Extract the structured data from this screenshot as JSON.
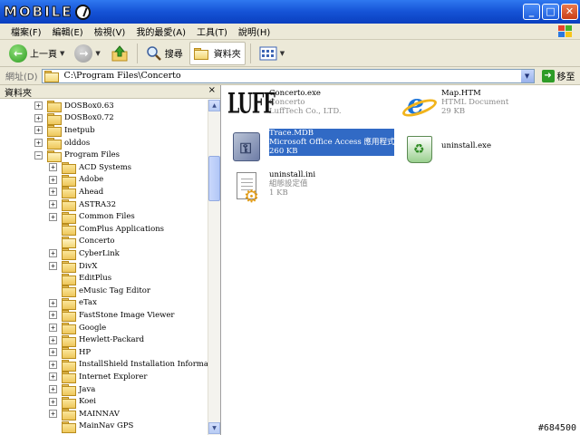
{
  "window": {
    "logo_text": "MOBILE",
    "controls": {
      "minimize": "_",
      "maximize": "□",
      "close": "✕"
    }
  },
  "menu": [
    "檔案(F)",
    "編輯(E)",
    "檢視(V)",
    "我的最愛(A)",
    "工具(T)",
    "說明(H)"
  ],
  "toolbar": {
    "back_label": "上一頁",
    "search_label": "搜尋",
    "folders_label": "資料夾"
  },
  "address": {
    "label": "網址(D)",
    "value": "C:\\Program Files\\Concerto",
    "go_label": "移至"
  },
  "folder_pane": {
    "title": "資料夾",
    "close": "×",
    "tree": [
      {
        "label": "DOSBox0.63",
        "level": 1,
        "expander": "+",
        "open": false
      },
      {
        "label": "DOSBox0.72",
        "level": 1,
        "expander": "+",
        "open": false
      },
      {
        "label": "Inetpub",
        "level": 1,
        "expander": "+",
        "open": false
      },
      {
        "label": "olddos",
        "level": 1,
        "expander": "+",
        "open": false
      },
      {
        "label": "Program Files",
        "level": 1,
        "expander": "−",
        "open": true
      },
      {
        "label": "ACD Systems",
        "level": 2,
        "expander": "+",
        "open": false
      },
      {
        "label": "Adobe",
        "level": 2,
        "expander": "+",
        "open": false
      },
      {
        "label": "Ahead",
        "level": 2,
        "expander": "+",
        "open": false
      },
      {
        "label": "ASTRA32",
        "level": 2,
        "expander": "+",
        "open": false
      },
      {
        "label": "Common Files",
        "level": 2,
        "expander": "+",
        "open": false
      },
      {
        "label": "ComPlus Applications",
        "level": 2,
        "expander": "",
        "open": false
      },
      {
        "label": "Concerto",
        "level": 2,
        "expander": "",
        "open": true
      },
      {
        "label": "CyberLink",
        "level": 2,
        "expander": "+",
        "open": false
      },
      {
        "label": "DivX",
        "level": 2,
        "expander": "+",
        "open": false
      },
      {
        "label": "EditPlus",
        "level": 2,
        "expander": "",
        "open": false
      },
      {
        "label": "eMusic Tag Editor",
        "level": 2,
        "expander": "",
        "open": false
      },
      {
        "label": "eTax",
        "level": 2,
        "expander": "+",
        "open": false
      },
      {
        "label": "FastStone Image Viewer",
        "level": 2,
        "expander": "+",
        "open": false
      },
      {
        "label": "Google",
        "level": 2,
        "expander": "+",
        "open": false
      },
      {
        "label": "Hewlett-Packard",
        "level": 2,
        "expander": "+",
        "open": false
      },
      {
        "label": "HP",
        "level": 2,
        "expander": "+",
        "open": false
      },
      {
        "label": "InstallShield Installation Information",
        "level": 2,
        "expander": "+",
        "open": false
      },
      {
        "label": "Internet Explorer",
        "level": 2,
        "expander": "+",
        "open": false
      },
      {
        "label": "Java",
        "level": 2,
        "expander": "+",
        "open": false
      },
      {
        "label": "Koei",
        "level": 2,
        "expander": "+",
        "open": false
      },
      {
        "label": "MAINNAV",
        "level": 2,
        "expander": "+",
        "open": false
      },
      {
        "label": "MainNav GPS",
        "level": 2,
        "expander": "",
        "open": false
      }
    ]
  },
  "files": [
    {
      "name": "Concerto.exe",
      "line2": "Concerto",
      "line3": "LuffTech Co., LTD.",
      "icon": "luff-app-icon"
    },
    {
      "name": "Map.HTM",
      "line2": "HTML Document",
      "line3": "29 KB",
      "icon": "ie-html-icon"
    },
    {
      "name": "Trace.MDB",
      "line2": "Microsoft Office Access 應用程式",
      "line3": "260 KB",
      "icon": "access-db-icon",
      "selected": true
    },
    {
      "name": "uninstall.exe",
      "line2": "",
      "line3": "",
      "icon": "uninstall-icon"
    },
    {
      "name": "uninstall.ini",
      "line2": "組態設定值",
      "line3": "1 KB",
      "icon": "ini-settings-icon"
    }
  ],
  "watermark": "#684500"
}
